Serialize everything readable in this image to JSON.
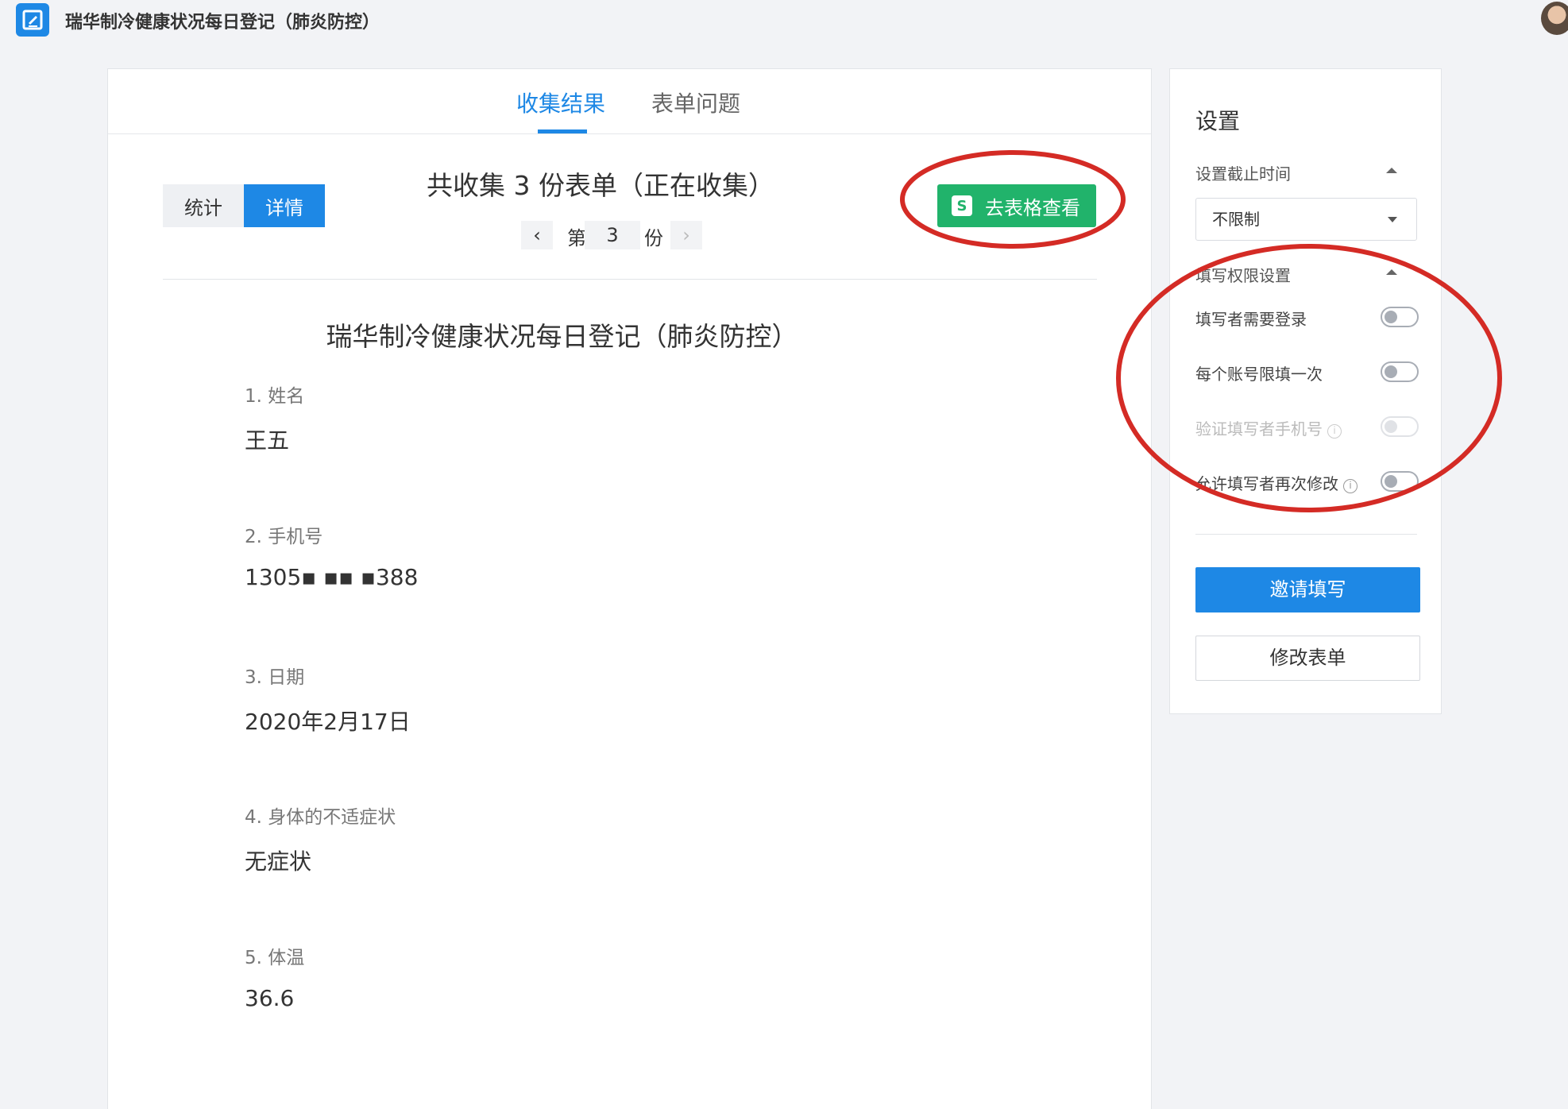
{
  "app": {
    "title": "瑞华制冷健康状况每日登记（肺炎防控）"
  },
  "tabs": [
    {
      "label": "收集结果",
      "active": true
    },
    {
      "label": "表单问题",
      "active": false
    }
  ],
  "view_toggle": {
    "stats_label": "统计",
    "detail_label": "详情",
    "selected": "详情"
  },
  "summary": {
    "text": "共收集 3 份表单（正在收集）"
  },
  "pager": {
    "prev": "‹",
    "prefix": "第",
    "current": "3",
    "suffix": "份",
    "next": "›"
  },
  "excel_button": {
    "logo": "S",
    "label": "去表格查看"
  },
  "form": {
    "title": "瑞华制冷健康状况每日登记（肺炎防控）",
    "questions": [
      {
        "label": "1.  姓名",
        "answer": "王五"
      },
      {
        "label": "2.  手机号",
        "answer": "1305▪ ▪▪ ▪388"
      },
      {
        "label": "3.  日期",
        "answer": "2020年2月17日"
      },
      {
        "label": "4.  身体的不适症状",
        "answer": "无症状"
      },
      {
        "label": "5.  体温",
        "answer": "36.6"
      }
    ]
  },
  "settings": {
    "title": "设置",
    "deadline": {
      "label": "设置截止时间",
      "value": "不限制"
    },
    "permissions": {
      "label": "填写权限设置",
      "items": [
        {
          "label": "填写者需要登录",
          "enabled": false,
          "disabled": false,
          "info": false
        },
        {
          "label": "每个账号限填一次",
          "enabled": false,
          "disabled": false,
          "info": false
        },
        {
          "label": "验证填写者手机号",
          "enabled": false,
          "disabled": true,
          "info": true
        },
        {
          "label": "允许填写者再次修改",
          "enabled": false,
          "disabled": false,
          "info": true
        }
      ]
    },
    "invite_button": "邀请填写",
    "edit_button": "修改表单"
  },
  "colors": {
    "primary": "#1e88e5",
    "excel_green": "#21b36b",
    "annotation_red": "#d42b25"
  }
}
